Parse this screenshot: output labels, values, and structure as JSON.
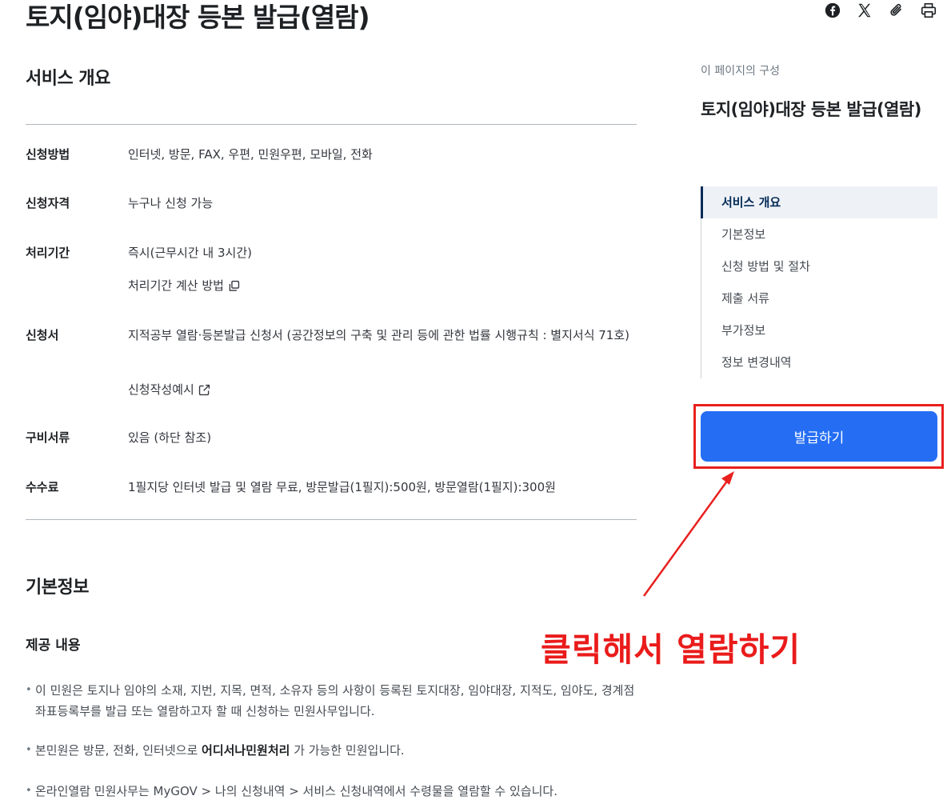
{
  "page": {
    "title": "토지(임야)대장 등본 발급(열람)"
  },
  "share": {
    "facebook_icon": "facebook-icon",
    "x_icon": "x-icon",
    "link_icon": "paperclip-icon",
    "print_icon": "print-icon"
  },
  "overview": {
    "title": "서비스 개요",
    "rows": [
      {
        "label": "신청방법",
        "value": "인터넷, 방문, FAX, 우편, 민원우편, 모바일, 전화"
      },
      {
        "label": "신청자격",
        "value": "누구나 신청 가능"
      },
      {
        "label": "처리기간",
        "value": "즉시(근무시간 내 3시간)",
        "link": "처리기간 계산 방법"
      },
      {
        "label": "신청서",
        "value": "지적공부 열람·등본발급 신청서 (공간정보의 구축 및 관리 등에 관한 법률 시행규칙 : 별지서식 71호)",
        "link": "신청작성예시"
      },
      {
        "label": "구비서류",
        "value": "있음 (하단 참조)"
      },
      {
        "label": "수수료",
        "value": "1필지당 인터넷 발급 및 열람 무료, 방문발급(1필지):500원, 방문열람(1필지):300원"
      }
    ]
  },
  "basic_info": {
    "title": "기본정보",
    "subtitle": "제공 내용",
    "bullets": [
      {
        "text": "이 민원은 토지나 임야의 소재, 지번, 지목, 면적, 소유자 등의 사항이 등록된 토지대장, 임야대장, 지적도, 임야도, 경계점좌표등록부를 발급 또는 열람하고자 할 때 신청하는 민원사무입니다."
      },
      {
        "pre": "본민원은 방문, 전화, 인터넷으로 ",
        "bold": "어디서나민원처리",
        "post": " 가 가능한 민원입니다."
      },
      {
        "text": "온라인열람 민원사무는 MyGOV > 나의 신청내역 > 서비스 신청내역에서 수령물을 열람할 수 있습니다."
      }
    ]
  },
  "toc": {
    "caption": "이 페이지의 구성",
    "title": "토지(임야)대장 등본 발급(열람)",
    "items": [
      "서비스 개요",
      "기본정보",
      "신청 방법 및 절차",
      "제출 서류",
      "부가정보",
      "정보 변경내역"
    ],
    "active_index": 0
  },
  "issue_button": {
    "label": "발급하기"
  },
  "annotation": {
    "text": "클릭해서 열람하기",
    "color": "#ea1b1b"
  },
  "colors": {
    "primary": "#256ef4",
    "toc_active": "#052b57",
    "annotation_red": "#e8201e"
  }
}
